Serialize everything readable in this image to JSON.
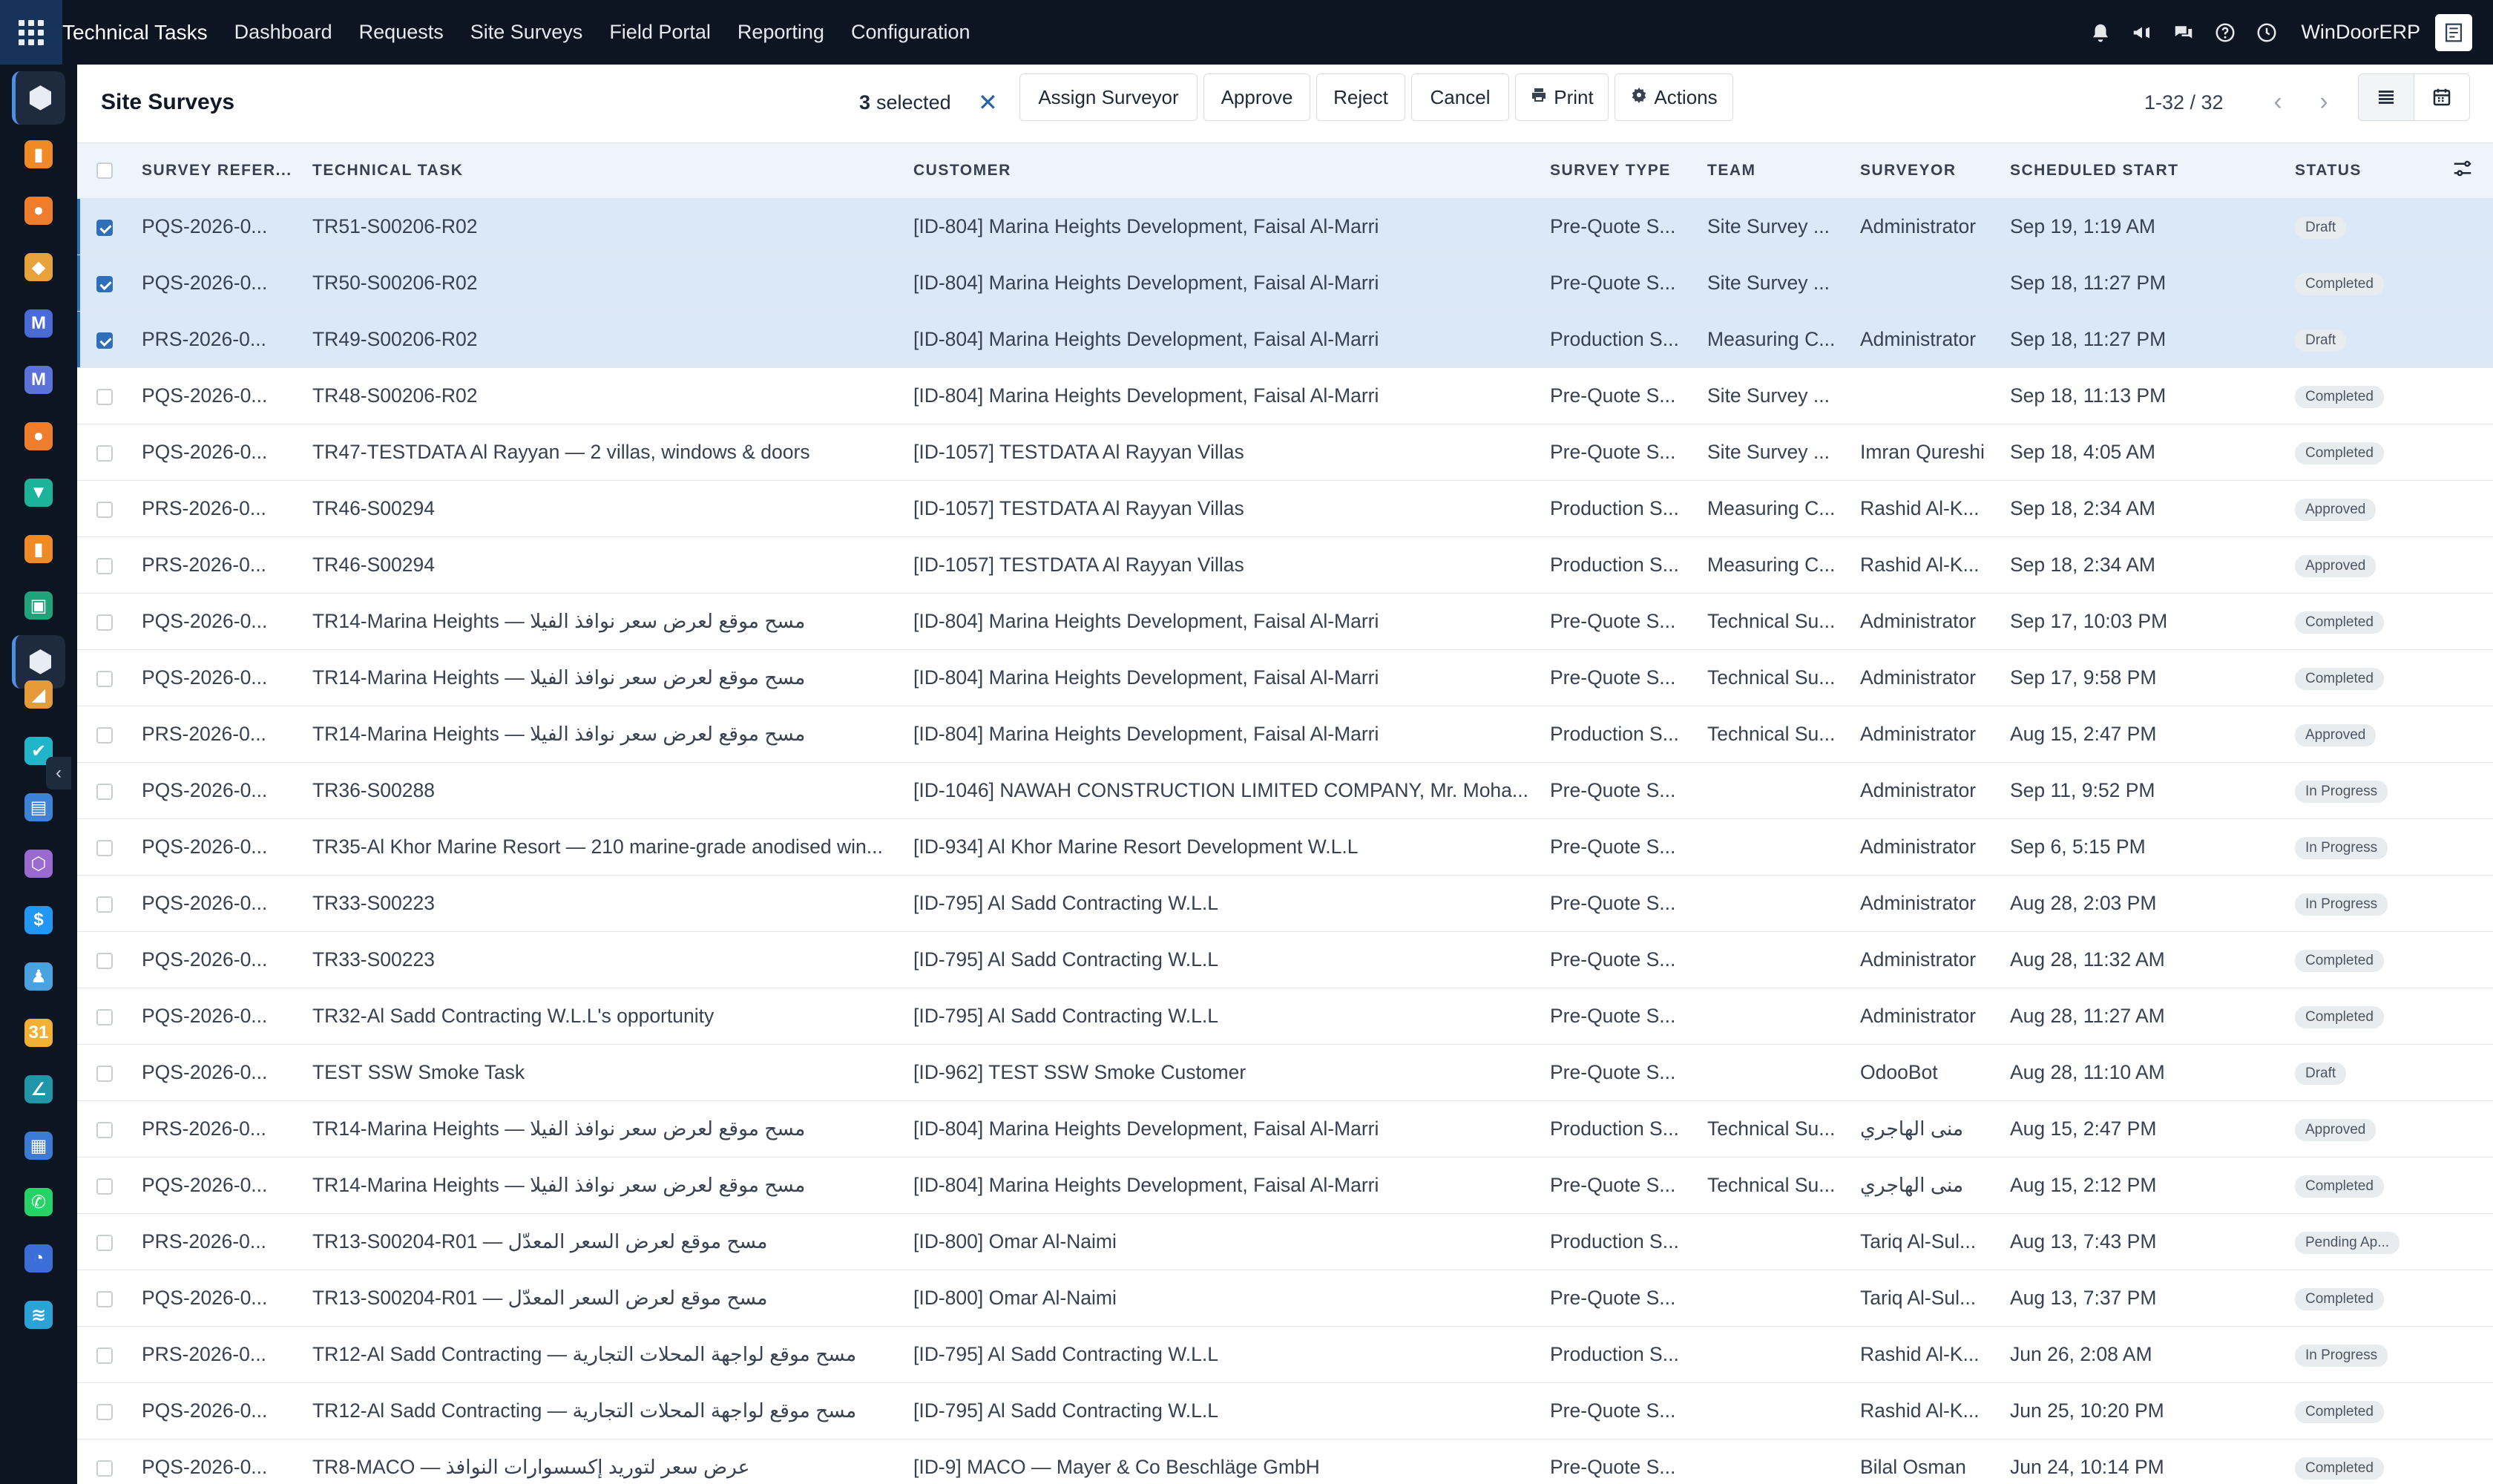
{
  "topbar": {
    "brand": "Technical Tasks",
    "menu": [
      "Dashboard",
      "Requests",
      "Site Surveys",
      "Field Portal",
      "Reporting",
      "Configuration"
    ],
    "company": "WinDoorERP",
    "icons": [
      "bell-icon",
      "megaphone-icon",
      "chat-icon",
      "help-icon",
      "clock-icon"
    ]
  },
  "rail": {
    "apps": [
      {
        "name": "technical-tasks-app",
        "color": "#e8edf5",
        "glyph": "⬢",
        "active": true
      },
      {
        "name": "reporting-app",
        "color": "#f08a24",
        "glyph": "▮"
      },
      {
        "name": "discuss-app",
        "color": "#f07d2b",
        "glyph": "●"
      },
      {
        "name": "website-app",
        "color": "#e8a23a",
        "glyph": "◆"
      },
      {
        "name": "mail-app",
        "color": "#4a6bd6",
        "glyph": "M"
      },
      {
        "name": "mail-marketing-app",
        "color": "#5b73d9",
        "glyph": "M"
      },
      {
        "name": "live-chat-app",
        "color": "#f07d2b",
        "glyph": "●"
      },
      {
        "name": "crm-app",
        "color": "#1cb39a",
        "glyph": "▼"
      },
      {
        "name": "sales-app",
        "color": "#f08a24",
        "glyph": "▮"
      },
      {
        "name": "contacts-app",
        "color": "#1fa37b",
        "glyph": "▣"
      },
      {
        "name": "inventory-app",
        "color": "#e8edf5",
        "glyph": "⬢",
        "active": true
      },
      {
        "name": "field-service-app",
        "color": "#e69a3a",
        "glyph": "◢"
      },
      {
        "name": "project-app",
        "color": "#21b5c9",
        "glyph": "✔"
      },
      {
        "name": "helpdesk-app",
        "color": "#3c82d6",
        "glyph": "▤"
      },
      {
        "name": "manufacturing-app",
        "color": "#9a6ad1",
        "glyph": "⬡"
      },
      {
        "name": "invoicing-app",
        "color": "#2196f3",
        "glyph": "$"
      },
      {
        "name": "employees-app",
        "color": "#4aa3e0",
        "glyph": "♟"
      },
      {
        "name": "calendar-app",
        "color": "#f2b135",
        "glyph": "31"
      },
      {
        "name": "sign-app",
        "color": "#2196a8",
        "glyph": "∠"
      },
      {
        "name": "dashboards-app",
        "color": "#3b7bd6",
        "glyph": "▦"
      },
      {
        "name": "whatsapp-app",
        "color": "#25d366",
        "glyph": "✆"
      },
      {
        "name": "timesheets-app",
        "color": "#3b6ed6",
        "glyph": "◔"
      },
      {
        "name": "odoo-app",
        "color": "#2ba3d6",
        "glyph": "≋"
      }
    ]
  },
  "control": {
    "title": "Site Surveys",
    "selected_count": "3",
    "selected_label": "selected",
    "clear_selection": "✕",
    "buttons": {
      "assign": "Assign Surveyor",
      "approve": "Approve",
      "reject": "Reject",
      "cancel": "Cancel",
      "print": "Print",
      "actions": "Actions"
    },
    "pager": "1-32 / 32"
  },
  "table": {
    "headers": {
      "ref": "SURVEY REFER...",
      "task": "TECHNICAL TASK",
      "customer": "CUSTOMER",
      "type": "SURVEY TYPE",
      "team": "TEAM",
      "surveyor": "SURVEYOR",
      "start": "SCHEDULED START",
      "status": "STATUS"
    },
    "rows": [
      {
        "selected": true,
        "ref": "PQS-2026-0...",
        "task": "TR51-S00206-R02",
        "customer": "[ID-804] Marina Heights Development, Faisal Al-Marri",
        "type": "Pre-Quote S...",
        "team": "Site Survey ...",
        "surveyor": "Administrator",
        "start": "Sep 19, 1:19 AM",
        "status": "Draft"
      },
      {
        "selected": true,
        "ref": "PQS-2026-0...",
        "task": "TR50-S00206-R02",
        "customer": "[ID-804] Marina Heights Development, Faisal Al-Marri",
        "type": "Pre-Quote S...",
        "team": "Site Survey ...",
        "surveyor": "",
        "start": "Sep 18, 11:27 PM",
        "status": "Completed"
      },
      {
        "selected": true,
        "ref": "PRS-2026-0...",
        "task": "TR49-S00206-R02",
        "customer": "[ID-804] Marina Heights Development, Faisal Al-Marri",
        "type": "Production S...",
        "team": "Measuring C...",
        "surveyor": "Administrator",
        "start": "Sep 18, 11:27 PM",
        "status": "Draft"
      },
      {
        "selected": false,
        "ref": "PQS-2026-0...",
        "task": "TR48-S00206-R02",
        "customer": "[ID-804] Marina Heights Development, Faisal Al-Marri",
        "type": "Pre-Quote S...",
        "team": "Site Survey ...",
        "surveyor": "",
        "start": "Sep 18, 11:13 PM",
        "status": "Completed"
      },
      {
        "selected": false,
        "ref": "PQS-2026-0...",
        "task": "TR47-TESTDATA Al Rayyan — 2 villas, windows & doors",
        "customer": "[ID-1057] TESTDATA Al Rayyan Villas",
        "type": "Pre-Quote S...",
        "team": "Site Survey ...",
        "surveyor": "Imran Qureshi",
        "start": "Sep 18, 4:05 AM",
        "status": "Completed"
      },
      {
        "selected": false,
        "ref": "PRS-2026-0...",
        "task": "TR46-S00294",
        "customer": "[ID-1057] TESTDATA Al Rayyan Villas",
        "type": "Production S...",
        "team": "Measuring C...",
        "surveyor": "Rashid Al-K...",
        "start": "Sep 18, 2:34 AM",
        "status": "Approved"
      },
      {
        "selected": false,
        "ref": "PRS-2026-0...",
        "task": "TR46-S00294",
        "customer": "[ID-1057] TESTDATA Al Rayyan Villas",
        "type": "Production S...",
        "team": "Measuring C...",
        "surveyor": "Rashid Al-K...",
        "start": "Sep 18, 2:34 AM",
        "status": "Approved"
      },
      {
        "selected": false,
        "ref": "PQS-2026-0...",
        "task": "TR14-Marina Heights — مسح موقع لعرض سعر نوافذ الفيلا",
        "customer": "[ID-804] Marina Heights Development, Faisal Al-Marri",
        "type": "Pre-Quote S...",
        "team": "Technical Su...",
        "surveyor": "Administrator",
        "start": "Sep 17, 10:03 PM",
        "status": "Completed"
      },
      {
        "selected": false,
        "ref": "PQS-2026-0...",
        "task": "TR14-Marina Heights — مسح موقع لعرض سعر نوافذ الفيلا",
        "customer": "[ID-804] Marina Heights Development, Faisal Al-Marri",
        "type": "Pre-Quote S...",
        "team": "Technical Su...",
        "surveyor": "Administrator",
        "start": "Sep 17, 9:58 PM",
        "status": "Completed"
      },
      {
        "selected": false,
        "ref": "PRS-2026-0...",
        "task": "TR14-Marina Heights — مسح موقع لعرض سعر نوافذ الفيلا",
        "customer": "[ID-804] Marina Heights Development, Faisal Al-Marri",
        "type": "Production S...",
        "team": "Technical Su...",
        "surveyor": "Administrator",
        "start": "Aug 15, 2:47 PM",
        "status": "Approved"
      },
      {
        "selected": false,
        "ref": "PQS-2026-0...",
        "task": "TR36-S00288",
        "customer": "[ID-1046] NAWAH CONSTRUCTION LIMITED COMPANY, Mr. Moha...",
        "type": "Pre-Quote S...",
        "team": "",
        "surveyor": "Administrator",
        "start": "Sep 11, 9:52 PM",
        "status": "In Progress"
      },
      {
        "selected": false,
        "ref": "PQS-2026-0...",
        "task": "TR35-Al Khor Marine Resort — 210 marine-grade anodised win...",
        "customer": "[ID-934] Al Khor Marine Resort Development W.L.L",
        "type": "Pre-Quote S...",
        "team": "",
        "surveyor": "Administrator",
        "start": "Sep 6, 5:15 PM",
        "status": "In Progress"
      },
      {
        "selected": false,
        "ref": "PQS-2026-0...",
        "task": "TR33-S00223",
        "customer": "[ID-795] Al Sadd Contracting W.L.L",
        "type": "Pre-Quote S...",
        "team": "",
        "surveyor": "Administrator",
        "start": "Aug 28, 2:03 PM",
        "status": "In Progress"
      },
      {
        "selected": false,
        "ref": "PQS-2026-0...",
        "task": "TR33-S00223",
        "customer": "[ID-795] Al Sadd Contracting W.L.L",
        "type": "Pre-Quote S...",
        "team": "",
        "surveyor": "Administrator",
        "start": "Aug 28, 11:32 AM",
        "status": "Completed"
      },
      {
        "selected": false,
        "ref": "PQS-2026-0...",
        "task": "TR32-Al Sadd Contracting W.L.L's opportunity",
        "customer": "[ID-795] Al Sadd Contracting W.L.L",
        "type": "Pre-Quote S...",
        "team": "",
        "surveyor": "Administrator",
        "start": "Aug 28, 11:27 AM",
        "status": "Completed"
      },
      {
        "selected": false,
        "ref": "PQS-2026-0...",
        "task": "TEST SSW Smoke Task",
        "customer": "[ID-962] TEST SSW Smoke Customer",
        "type": "Pre-Quote S...",
        "team": "",
        "surveyor": "OdooBot",
        "start": "Aug 28, 11:10 AM",
        "status": "Draft"
      },
      {
        "selected": false,
        "ref": "PRS-2026-0...",
        "task": "TR14-Marina Heights — مسح موقع لعرض سعر نوافذ الفيلا",
        "customer": "[ID-804] Marina Heights Development, Faisal Al-Marri",
        "type": "Production S...",
        "team": "Technical Su...",
        "surveyor": "منى الهاجري",
        "start": "Aug 15, 2:47 PM",
        "status": "Approved"
      },
      {
        "selected": false,
        "ref": "PQS-2026-0...",
        "task": "TR14-Marina Heights — مسح موقع لعرض سعر نوافذ الفيلا",
        "customer": "[ID-804] Marina Heights Development, Faisal Al-Marri",
        "type": "Pre-Quote S...",
        "team": "Technical Su...",
        "surveyor": "منى الهاجري",
        "start": "Aug 15, 2:12 PM",
        "status": "Completed"
      },
      {
        "selected": false,
        "ref": "PRS-2026-0...",
        "task": "TR13-S00204-R01 — مسح موقع لعرض السعر المعدّل",
        "customer": "[ID-800] Omar Al-Naimi",
        "type": "Production S...",
        "team": "",
        "surveyor": "Tariq Al-Sul...",
        "start": "Aug 13, 7:43 PM",
        "status": "Pending Ap..."
      },
      {
        "selected": false,
        "ref": "PQS-2026-0...",
        "task": "TR13-S00204-R01 — مسح موقع لعرض السعر المعدّل",
        "customer": "[ID-800] Omar Al-Naimi",
        "type": "Pre-Quote S...",
        "team": "",
        "surveyor": "Tariq Al-Sul...",
        "start": "Aug 13, 7:37 PM",
        "status": "Completed"
      },
      {
        "selected": false,
        "ref": "PRS-2026-0...",
        "task": "TR12-Al Sadd Contracting — مسح موقع لواجهة المحلات التجارية",
        "customer": "[ID-795] Al Sadd Contracting W.L.L",
        "type": "Production S...",
        "team": "",
        "surveyor": "Rashid Al-K...",
        "start": "Jun 26, 2:08 AM",
        "status": "In Progress"
      },
      {
        "selected": false,
        "ref": "PQS-2026-0...",
        "task": "TR12-Al Sadd Contracting — مسح موقع لواجهة المحلات التجارية",
        "customer": "[ID-795] Al Sadd Contracting W.L.L",
        "type": "Pre-Quote S...",
        "team": "",
        "surveyor": "Rashid Al-K...",
        "start": "Jun 25, 10:20 PM",
        "status": "Completed"
      },
      {
        "selected": false,
        "ref": "PQS-2026-0...",
        "task": "TR8-MACO — عرض سعر لتوريد إكسسوارات النوافذ",
        "customer": "[ID-9] MACO — Mayer & Co Beschläge GmbH",
        "type": "Pre-Quote S...",
        "team": "",
        "surveyor": "Bilal Osman",
        "start": "Jun 24, 10:14 PM",
        "status": "Completed"
      }
    ]
  }
}
